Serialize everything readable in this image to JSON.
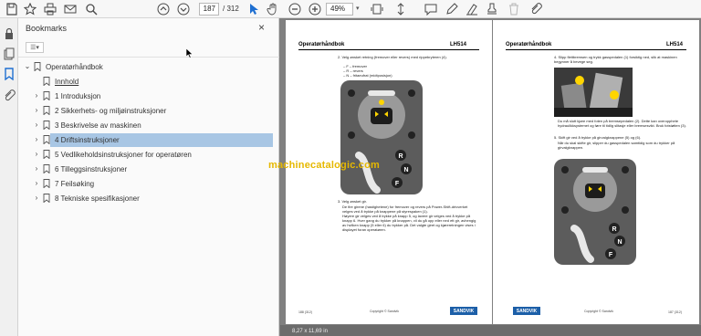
{
  "toolbar": {
    "current_page": "187",
    "total_pages": "/ 312",
    "zoom": "49%"
  },
  "bookmarks_panel": {
    "title": "Bookmarks",
    "close_glyph": "×",
    "items": [
      {
        "label": "Operatørhåndbok",
        "level": 0,
        "expand": "open"
      },
      {
        "label": "Innhold",
        "level": 1,
        "expand": "none"
      },
      {
        "label": "1 Introduksjon",
        "level": 1,
        "expand": "closed"
      },
      {
        "label": "2 Sikkerhets- og miljøinstruksjoner",
        "level": 1,
        "expand": "closed"
      },
      {
        "label": "3 Beskrivelse av maskinen",
        "level": 1,
        "expand": "closed"
      },
      {
        "label": "4 Driftsinstruksjoner",
        "level": 1,
        "expand": "closed",
        "selected": true
      },
      {
        "label": "5 Vedlikeholdsinstruksjoner for operatøren",
        "level": 1,
        "expand": "closed"
      },
      {
        "label": "6 Tilleggsinstruksjoner",
        "level": 1,
        "expand": "closed"
      },
      {
        "label": "7 Feilsøking",
        "level": 1,
        "expand": "closed"
      },
      {
        "label": "8 Tekniske spesifikasjoner",
        "level": 1,
        "expand": "closed"
      }
    ]
  },
  "page_left": {
    "header_title": "Operatørhåndbok",
    "header_model": "LH514",
    "step_2": "2. Velg ønsket retning (fremover eller revers) med rippebryteren (4).",
    "step_2_sub": "– F – fremover\n– R – revers\n– N – fritaeufrat (midtposisjon)",
    "step_3": "3. Velg ønsket gir.",
    "step_3_body": "De fire girene (hastighetene) for fremover og revers på Power-Shift-drivverket velges ved å trykke på knappene på styrespaken (1).\nHøyere gir velges ved å trykke på knapp 5, og lavere gir velges ved å trykke på knapp 6. Hver gang du trykker på knappen, vil du gå opp eller ned ett gir, avhengig av hvilken knapp (5 eller 6) du trykker på. Det valgte giret og kjøreretningen vises i displayet foran operatøren.",
    "footer_left": "188 (312)",
    "footer_copy": "Copyright © Sandvik",
    "footer_brand": "SANDVIK"
  },
  "page_right": {
    "header_title": "Operatørhåndbok",
    "header_model": "LH514",
    "step_4": "4. Slipp flettbremsen og trykk gasspedalen (1) forsiktig ned, slik at maskinen begynner å bevege seg.",
    "step_4_body": "Du må slutt kjøre med foten på bremsepedalen (2). Dette kan overopphete hydraulikksystemet og føre til tidlig slitasje eller bremsesvikt. Bruk fotstøtten (3).",
    "step_5": "5. Skift gir ved å trykke på girvalgknappene (5) og (6).",
    "step_5_body": "Når du skal skifte gir, slipper du gasspedalen samtidig som du trykker på girvalgknappen.",
    "footer_brand": "SANDVIK",
    "footer_copy": "Copyright © Sandvik",
    "footer_right": "187 (312)"
  },
  "watermark": "machinecatalogic.com",
  "statusbar": "8,27 x 11,69 in",
  "colors": {
    "selection": "#a8c6e4",
    "accent": "#1f6fd1",
    "brand": "#1c5fa8",
    "watermark": "#e6b800"
  }
}
